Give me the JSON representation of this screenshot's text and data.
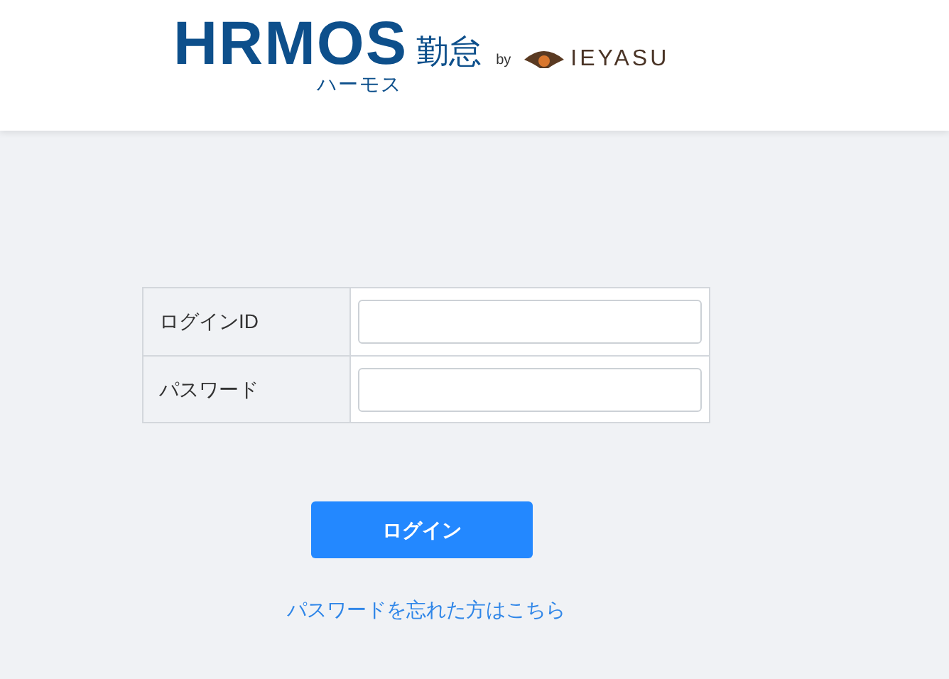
{
  "logo": {
    "brand": "HRMOS",
    "product": "勤怠",
    "reading": "ハーモス",
    "by": "by",
    "partner": "IEYASU"
  },
  "form": {
    "fields": [
      {
        "label": "ログインID"
      },
      {
        "label": "パスワード"
      }
    ]
  },
  "login_button": "ログイン",
  "forgot_link": "パスワードを忘れた方はこちら"
}
